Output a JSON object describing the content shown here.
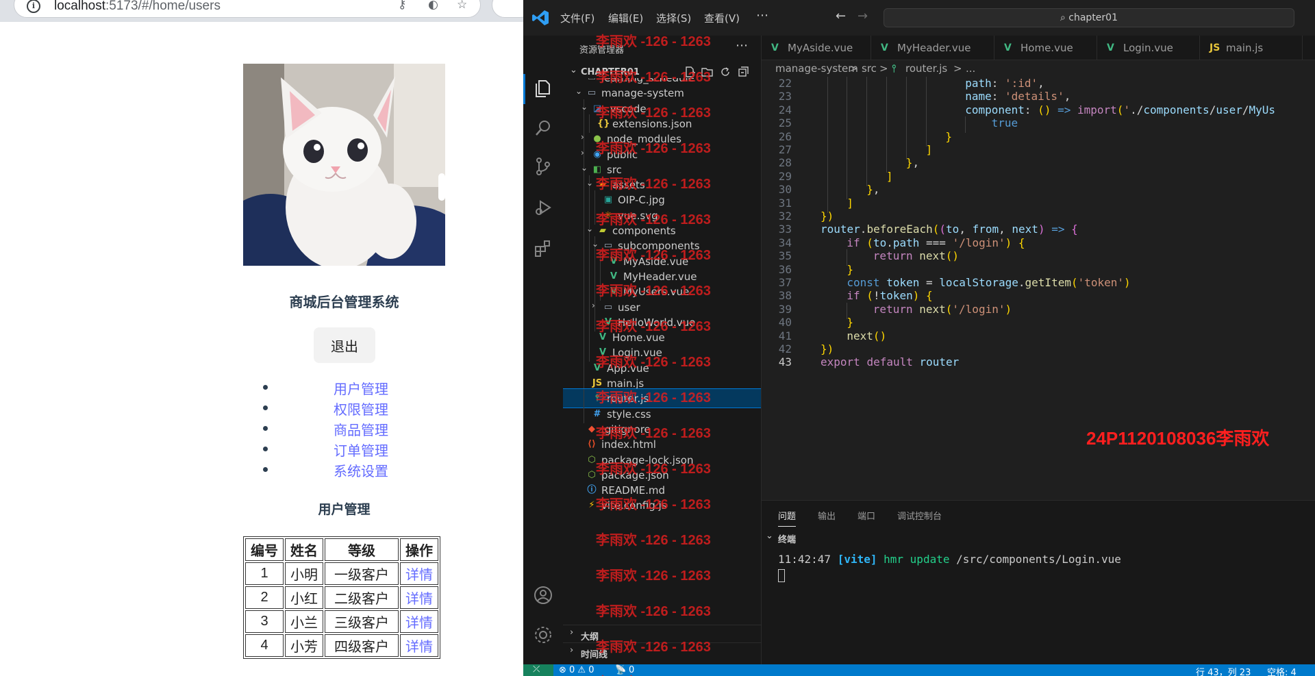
{
  "browser": {
    "url_host": "localhost",
    "url_path": ":5173/#/home/users"
  },
  "app": {
    "title": "商城后台管理系统",
    "logout_label": "退出",
    "nav": [
      "用户管理",
      "权限管理",
      "商品管理",
      "订单管理",
      "系统设置"
    ],
    "users_title": "用户管理",
    "table": {
      "headers": [
        "编号",
        "姓名",
        "等级",
        "操作"
      ],
      "rows": [
        [
          "1",
          "小明",
          "一级客户",
          "详情"
        ],
        [
          "2",
          "小红",
          "二级客户",
          "详情"
        ],
        [
          "3",
          "小兰",
          "三级客户",
          "详情"
        ],
        [
          "4",
          "小芳",
          "四级客户",
          "详情"
        ]
      ]
    }
  },
  "vscode": {
    "menu": [
      "文件(F)",
      "编辑(E)",
      "选择(S)",
      "查看(V)"
    ],
    "search_box": "chapter01",
    "explorer_title": "资源管理器",
    "workspace": "CHAPTER01",
    "tree": [
      {
        "label": "learning_schedule"
      },
      {
        "label": "manage-system"
      },
      {
        "label": ".vscode"
      },
      {
        "label": "extensions.json"
      },
      {
        "label": "node_modules"
      },
      {
        "label": "public"
      },
      {
        "label": "src"
      },
      {
        "label": "assets"
      },
      {
        "label": "OIP-C.jpg"
      },
      {
        "label": "vue.svg"
      },
      {
        "label": "components"
      },
      {
        "label": "subcomponents"
      },
      {
        "label": "MyAside.vue"
      },
      {
        "label": "MyHeader.vue"
      },
      {
        "label": "MyUsers.vue"
      },
      {
        "label": "user"
      },
      {
        "label": "HelloWorld.vue"
      },
      {
        "label": "Home.vue"
      },
      {
        "label": "Login.vue"
      },
      {
        "label": "App.vue"
      },
      {
        "label": "main.js"
      },
      {
        "label": "router.js"
      },
      {
        "label": "style.css"
      },
      {
        "label": ".gitignore"
      },
      {
        "label": "index.html"
      },
      {
        "label": "package-lock.json"
      },
      {
        "label": "package.json"
      },
      {
        "label": "README.md"
      },
      {
        "label": "vite.config.js"
      }
    ],
    "outline_label": "大纲",
    "timeline_label": "时间线",
    "tabs": [
      "MyAside.vue",
      "MyHeader.vue",
      "Home.vue",
      "Login.vue",
      "main.js"
    ],
    "breadcrumbs": [
      "manage-system",
      ">",
      "src",
      ">",
      "router.js",
      ">",
      "..."
    ],
    "line_numbers": [
      "22",
      "23",
      "24",
      "25",
      "26",
      "27",
      "28",
      "29",
      "30",
      "31",
      "32",
      "33",
      "34",
      "35",
      "36",
      "37",
      "38",
      "39",
      "40",
      "41",
      "42",
      "43"
    ],
    "code": [
      "path: ':id',",
      "name: 'details',",
      "component: () => import('./components/user/MyUs",
      "true",
      "}",
      "]",
      "},",
      "]",
      "},",
      "]",
      "})",
      "router.beforeEach((to, from, next) => {",
      "if (to.path === '/login') {",
      "return next()",
      "}",
      "const token = localStorage.getItem('token')",
      "if (!token) {",
      "return next('/login')",
      "}",
      "next()",
      "})",
      "export default router"
    ],
    "student_id": "24P1120108036李雨欢",
    "panel_tabs": [
      "问题",
      "输出",
      "端口",
      "调试控制台"
    ],
    "terminal_label": "终端",
    "terminal_output": "11:42:47 [vite] hmr update /src/components/Login.vue",
    "status": {
      "errors": "⊗ 0 ⚠ 0",
      "ports": "0",
      "position": "行 43，列 23",
      "spaces": "空格: 4"
    },
    "watermark": "李雨欢 -126 - 1263"
  },
  "colors": {
    "link": "#646cff",
    "vscode_bg": "#1f1f1f",
    "status_bar": "#007acc",
    "watermark": "#dc1e1e"
  }
}
